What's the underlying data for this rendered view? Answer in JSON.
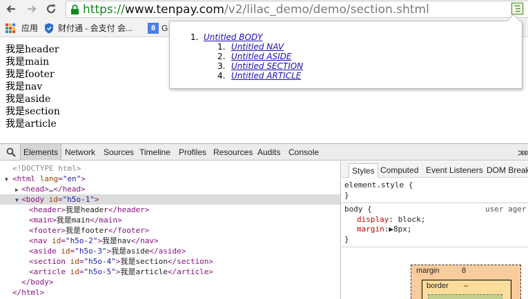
{
  "browser": {
    "url_protocol": "https://",
    "url_host": "www.tenpay.com",
    "url_path": "/v2/lilac_demo/demo/section.shtml",
    "icons": {
      "back": "arrow-left",
      "forward": "arrow-right",
      "reload": "reload",
      "lock": "lock",
      "extension": "outline-extension"
    }
  },
  "bookmarks": [
    {
      "icon": "apps-grid",
      "label": "应用"
    },
    {
      "icon": "shield",
      "label": "财付通 - 会支付 会..."
    },
    {
      "icon": "google",
      "icon_text": "8",
      "label": "G"
    }
  ],
  "page": {
    "lines": [
      "我是header",
      "我是main",
      "我是footer",
      "我是nav",
      "我是aside",
      "我是section",
      "我是article"
    ]
  },
  "outline": {
    "root": {
      "num": "1.",
      "label": "Untitled BODY"
    },
    "children": [
      {
        "num": "1.",
        "label": "Untitled NAV"
      },
      {
        "num": "2.",
        "label": "Untitled ASIDE"
      },
      {
        "num": "3.",
        "label": "Untitled SECTION"
      },
      {
        "num": "4.",
        "label": "Untitled ARTICLE"
      }
    ]
  },
  "devtools": {
    "tabs": [
      "Elements",
      "Network",
      "Sources",
      "Timeline",
      "Profiles",
      "Resources",
      "Audits",
      "Console"
    ],
    "active_tab": "Elements",
    "drawer_glyph": "⋙",
    "dom": {
      "doctype": "<!DOCTYPE html>",
      "html_open": {
        "tag": "<html",
        "attr": "lang",
        "val": "\"en\"",
        "close": ">"
      },
      "head": {
        "open": "<head>",
        "ellipsis": "…",
        "close": "</head>"
      },
      "body_open": {
        "tag": "<body",
        "attr": "id",
        "val": "\"h5o-1\"",
        "close": ">"
      },
      "children": [
        {
          "open": "<header>",
          "text": "我是header",
          "close": "</header>",
          "attr": "",
          "val": ""
        },
        {
          "open": "<main>",
          "text": "我是main",
          "close": "</main>",
          "attr": "",
          "val": ""
        },
        {
          "open": "<footer>",
          "text": "我是footer",
          "close": "</footer>",
          "attr": "",
          "val": ""
        },
        {
          "open": "<nav",
          "attr": "id",
          "val": "\"h5o-2\"",
          "text": "我是nav",
          "close": "</nav>"
        },
        {
          "open": "<aside",
          "attr": "id",
          "val": "\"h5o-3\"",
          "text": "我是aside",
          "close": "</aside>"
        },
        {
          "open": "<section",
          "attr": "id",
          "val": "\"h5o-4\"",
          "text": "我是section",
          "close": "</section>"
        },
        {
          "open": "<article",
          "attr": "id",
          "val": "\"h5o-5\"",
          "text": "我是article",
          "close": "</article>"
        }
      ],
      "body_close": "</body>",
      "html_close": "</html>"
    },
    "styles_tabs": [
      "Styles",
      "Computed",
      "Event Listeners",
      "DOM Break"
    ],
    "styles_active": "Styles",
    "element_style": {
      "selector": "element.style {",
      "close": "}"
    },
    "body_rule": {
      "selector": "body {",
      "source": "user ager",
      "props": [
        {
          "name": "display",
          "value": "block;"
        },
        {
          "name": "margin",
          "value": "8px;",
          "expander": "▶"
        }
      ],
      "close": "}"
    },
    "box_model": {
      "margin_label": "margin",
      "margin_value": "8",
      "border_label": "border",
      "border_value": "–"
    }
  },
  "colors": {
    "url_green": "#0b8a1a",
    "link": "#1a0dab",
    "tag": "#881280",
    "attr_name": "#994500",
    "attr_value": "#1a1aa6",
    "css_prop": "#c80000"
  }
}
